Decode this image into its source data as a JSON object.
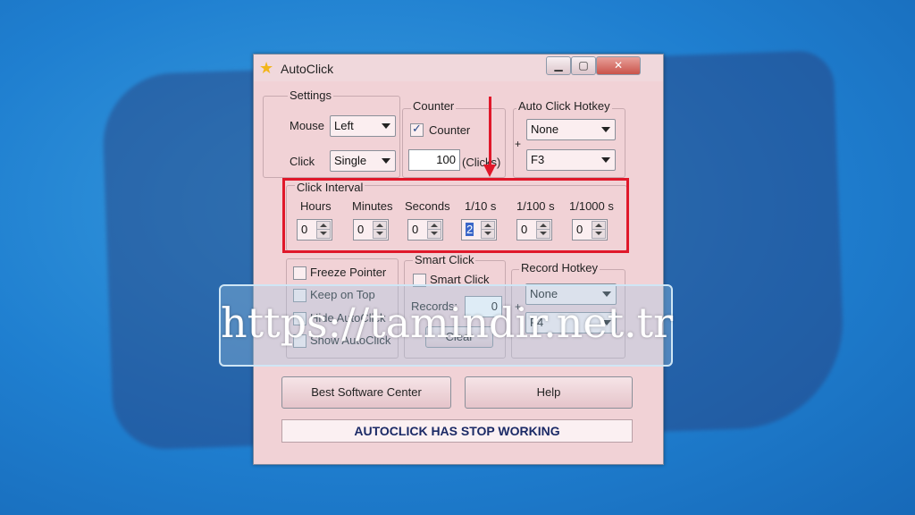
{
  "window": {
    "title": "AutoClick"
  },
  "settings": {
    "label": "Settings",
    "mouse_label": "Mouse",
    "mouse_value": "Left",
    "click_label": "Click",
    "click_value": "Single"
  },
  "counter": {
    "label": "Counter",
    "checkbox_label": "Counter",
    "checked": true,
    "value": "100",
    "unit": "(Clicks)"
  },
  "auto_hotkey": {
    "label": "Auto Click Hotkey",
    "modifier": "None",
    "key": "F3",
    "plus": "+"
  },
  "interval": {
    "label": "Click Interval",
    "fields": [
      {
        "label": "Hours",
        "value": "0"
      },
      {
        "label": "Minutes",
        "value": "0"
      },
      {
        "label": "Seconds",
        "value": "0"
      },
      {
        "label": "1/10 s",
        "value": "2"
      },
      {
        "label": "1/100 s",
        "value": "0"
      },
      {
        "label": "1/1000 s",
        "value": "0"
      }
    ]
  },
  "options": {
    "freeze": "Freeze Pointer",
    "keep_top": "Keep on Top",
    "hide": "Hide AutoClick",
    "show": "Show AutoClick"
  },
  "smart_click": {
    "label": "Smart Click",
    "checkbox_label": "Smart Click",
    "records_label": "Records:",
    "records_value": "0",
    "clear_label": "Clear"
  },
  "record_hotkey": {
    "label": "Record Hotkey",
    "modifier": "None",
    "key": "F4",
    "plus": "+"
  },
  "buttons": {
    "best_software": "Best Software Center",
    "help": "Help"
  },
  "status": "AUTOCLICK HAS STOP WORKING",
  "watermark": "https://tamindir.net.tr",
  "colors": {
    "highlight": "#e0182a",
    "status_text": "#1b2a66"
  }
}
